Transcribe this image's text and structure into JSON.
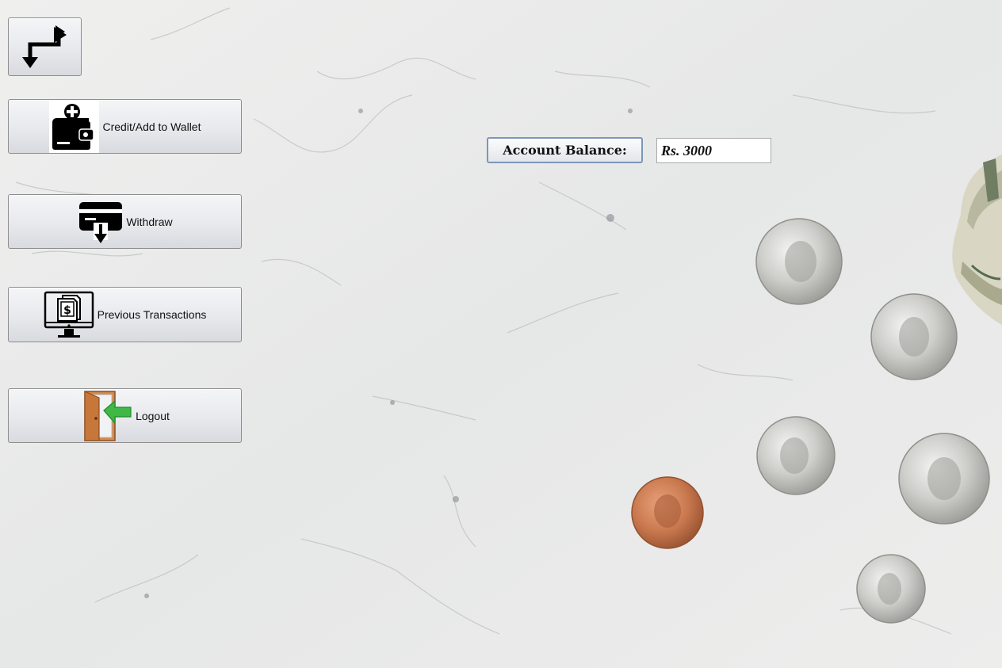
{
  "actions": {
    "credit_label": "Credit/Add to Wallet",
    "withdraw_label": "Withdraw",
    "history_label": "Previous Transactions",
    "logout_label": "Logout"
  },
  "account": {
    "balance_label": "Account Balance:",
    "balance_value": "Rs. 3000"
  },
  "icons": {
    "swap": "swap-arrows-icon",
    "credit": "wallet-add-icon",
    "withdraw": "card-withdraw-icon",
    "history": "monitor-receipt-icon",
    "logout": "door-exit-icon"
  },
  "colors": {
    "background": "#e9eaea",
    "button_border": "#8d8d8d",
    "label_border": "#7d96b8",
    "logout_arrow": "#3fb845",
    "door": "#c8773a"
  }
}
